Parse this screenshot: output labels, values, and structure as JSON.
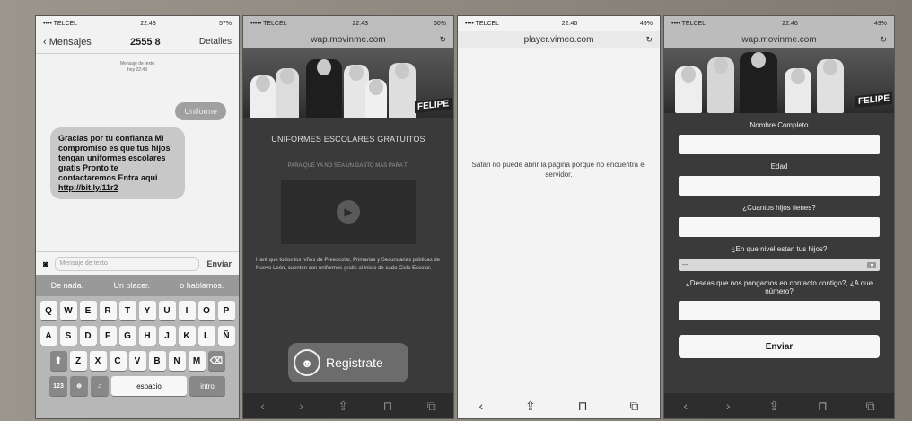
{
  "phone1": {
    "status": {
      "carrier": "•••• TELCEL",
      "time": "22:43",
      "battery": "57%"
    },
    "header": {
      "back": "Mensajes",
      "number": "2555 8",
      "details": "Detalles"
    },
    "meta": [
      "Mensaje de texto",
      "hoy 22:43"
    ],
    "sent": "Uniforme",
    "received": {
      "text": "Gracias por tu confianza Mi compromiso es que tus hijos tengan uniformes escolares gratis Pronto te contactaremos Entra aqui",
      "link": "http://bit.ly/11r2"
    },
    "compose": {
      "placeholder": "Mensaje de texto",
      "send": "Enviar"
    },
    "suggestions": [
      "De nada.",
      "Un placer.",
      "o hablamos."
    ],
    "rows": [
      [
        "Q",
        "W",
        "E",
        "R",
        "T",
        "Y",
        "U",
        "I",
        "O",
        "P"
      ],
      [
        "A",
        "S",
        "D",
        "F",
        "G",
        "H",
        "J",
        "K",
        "L",
        "Ñ"
      ],
      [
        "Z",
        "X",
        "C",
        "V",
        "B",
        "N",
        "M"
      ]
    ],
    "bottom": {
      "num": "123",
      "space": "espacio",
      "return": "intro"
    }
  },
  "phone2": {
    "status": {
      "carrier": "••••• TELCEL",
      "time": "22:43",
      "battery": "60%"
    },
    "url": "wap.movinme.com",
    "banner_label": "FELIPE",
    "heading": "UNIFORMES ESCOLARES GRATUITOS",
    "subheading": "PARA QUE YA NO SEA UN GASTO MAS PARA TI",
    "paragraph": "Haré que todos los niños de Preescolar, Primarias y Secundarias públicas de Nuevo León, cuenten con uniformes gratis al inicio de cada Ciclo Escolar.",
    "button": "Registrate"
  },
  "phone3": {
    "status": {
      "carrier": "•••• TELCEL",
      "time": "22:46",
      "battery": "49%"
    },
    "url": "player.vimeo.com",
    "error": "Safari no puede abrir la página porque no encuentra el servidor."
  },
  "phone4": {
    "status": {
      "carrier": "•••• TELCEL",
      "time": "22:46",
      "battery": "49%"
    },
    "url": "wap.movinme.com",
    "banner_label": "FELIPE",
    "fields": [
      "Nombre Completo",
      "Edad",
      "¿Cuantos hijos tienes?",
      "¿En que nivel estan tus hijos?",
      "¿Deseas que nos pongamos en contacto contigo?, ¿A que número?"
    ],
    "select_value": "---",
    "submit": "Enviar"
  },
  "toolbar_icons": [
    "back-icon",
    "forward-icon",
    "share-icon",
    "bookmarks-icon",
    "tabs-icon"
  ],
  "colors": {
    "keyboard_bg": "#b7b7b7",
    "site_dark": "#3a3a3a",
    "bubble_sent": "#a0a0a0",
    "bubble_received": "#c8c8c8"
  }
}
